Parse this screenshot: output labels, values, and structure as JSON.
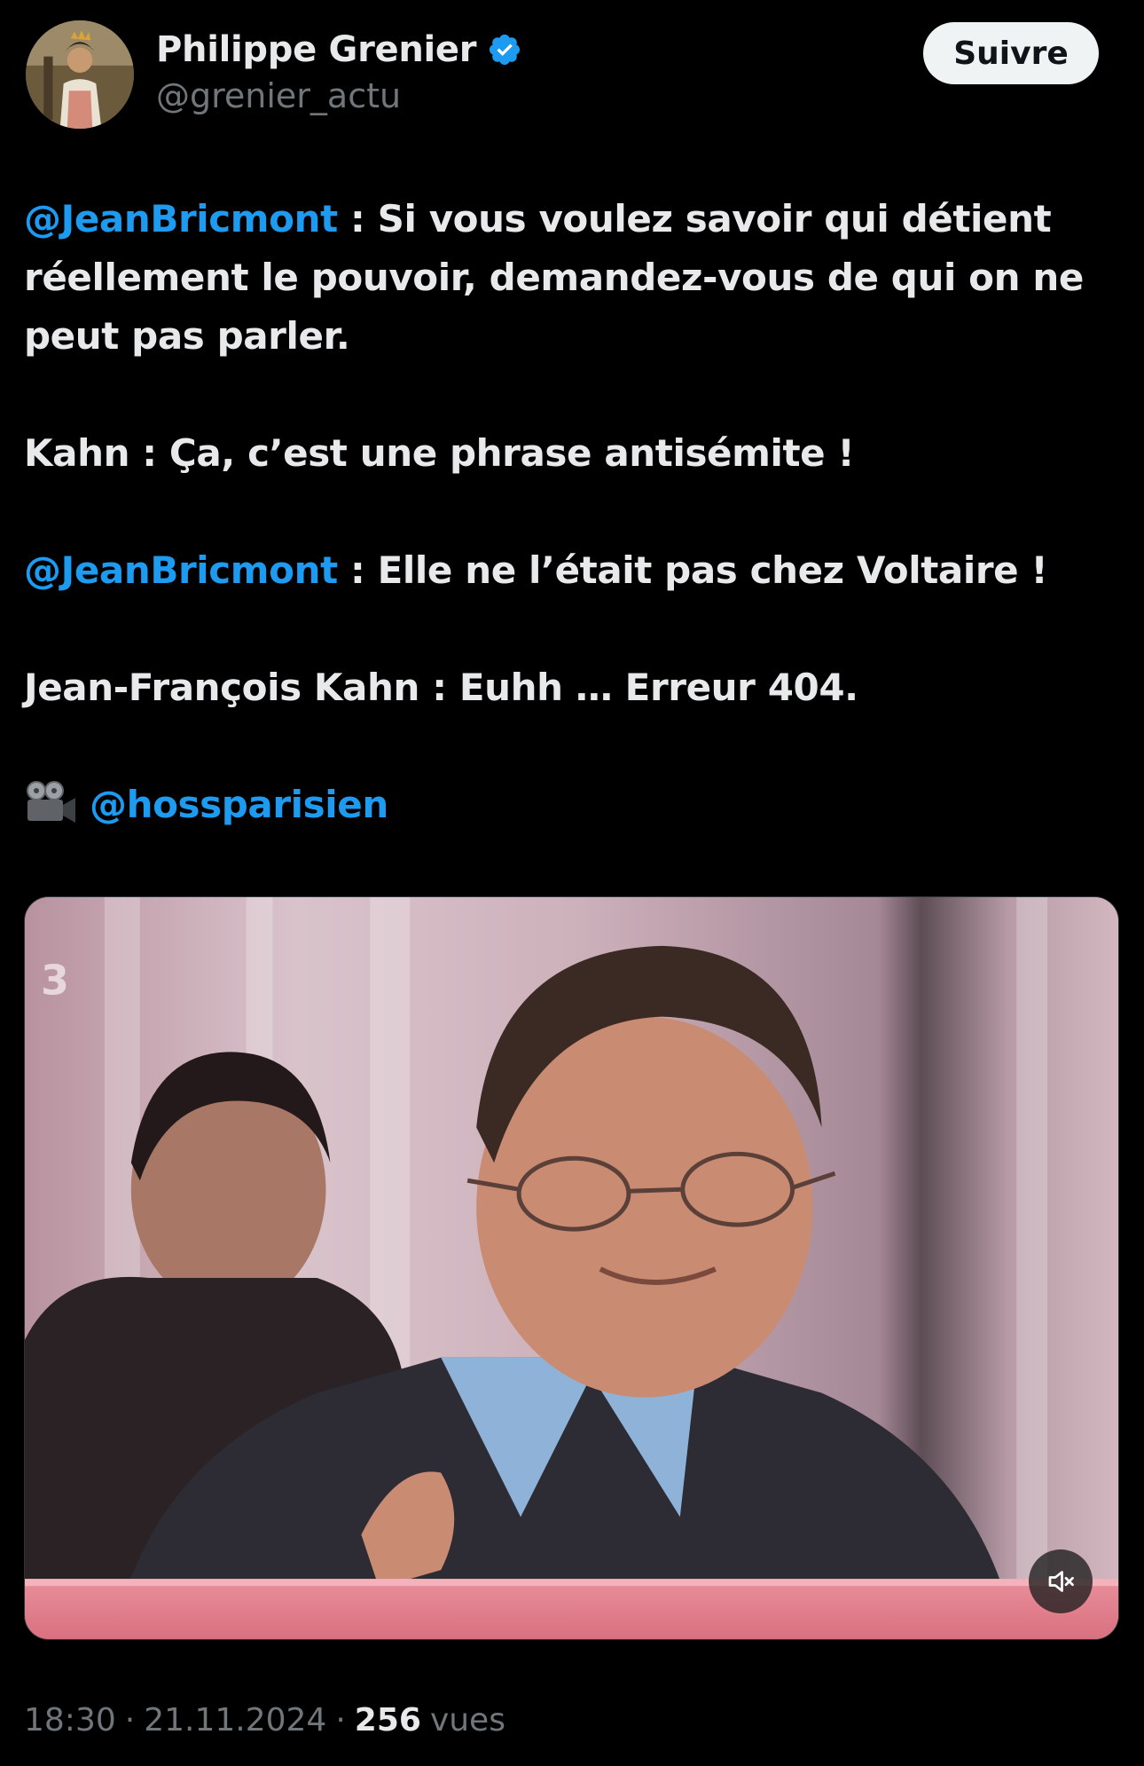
{
  "author": {
    "display_name": "Philippe Grenier",
    "handle": "@grenier_actu",
    "verified_icon": "verified-badge-icon"
  },
  "follow_label": "Suivre",
  "tweet": {
    "line1_mention": "@JeanBricmont",
    "line1_text": " : Si vous voulez savoir qui détient réellement le pouvoir, demandez-vous de qui on ne peut pas parler.",
    "line2_text": "Kahn : Ça, c’est une phrase antisémite !",
    "line3_mention": "@JeanBricmont",
    "line3_text": " : Elle ne l’était pas chez Voltaire !",
    "line4_text": "Jean-François Kahn : Euhh … Erreur 404.",
    "credit_icon": "movie-camera-icon",
    "credit_mention": "@hossparisien"
  },
  "media": {
    "kind": "video",
    "mute_icon": "volume-muted-icon"
  },
  "meta": {
    "time": "18:30",
    "sep1": "·",
    "date": "21.11.2024",
    "sep2": "·",
    "views_count": "256",
    "views_label": "vues"
  },
  "colors": {
    "background": "#000000",
    "text": "#e7e9ea",
    "secondary": "#71767b",
    "link": "#1d9bf0",
    "follow_bg": "#eff3f4"
  }
}
